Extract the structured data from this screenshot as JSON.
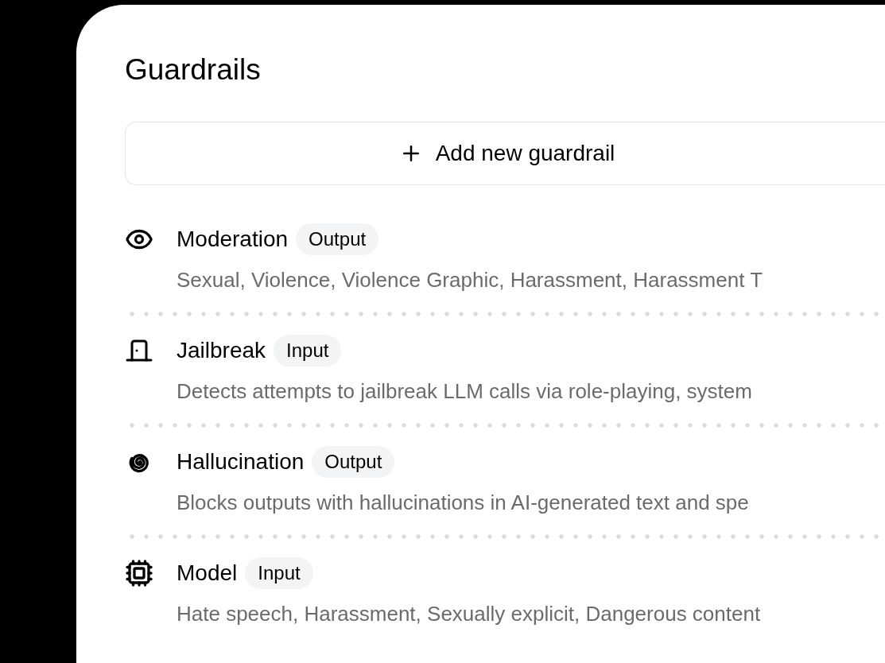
{
  "title": "Guardrails",
  "add_button": {
    "label": "Add new guardrail"
  },
  "guardrails": [
    {
      "kind": "eye",
      "name": "Moderation",
      "tag": "Output",
      "description": "Sexual, Violence, Violence Graphic, Harassment, Harassment T"
    },
    {
      "kind": "door",
      "name": "Jailbreak",
      "tag": "Input",
      "description": "Detects attempts to jailbreak LLM calls via role-playing, system"
    },
    {
      "kind": "spiral",
      "name": "Hallucination",
      "tag": "Output",
      "description": "Blocks outputs with hallucinations in AI-generated text and spe"
    },
    {
      "kind": "chip",
      "name": "Model",
      "tag": "Input",
      "description": "Hate speech, Harassment, Sexually explicit, Dangerous content"
    }
  ]
}
